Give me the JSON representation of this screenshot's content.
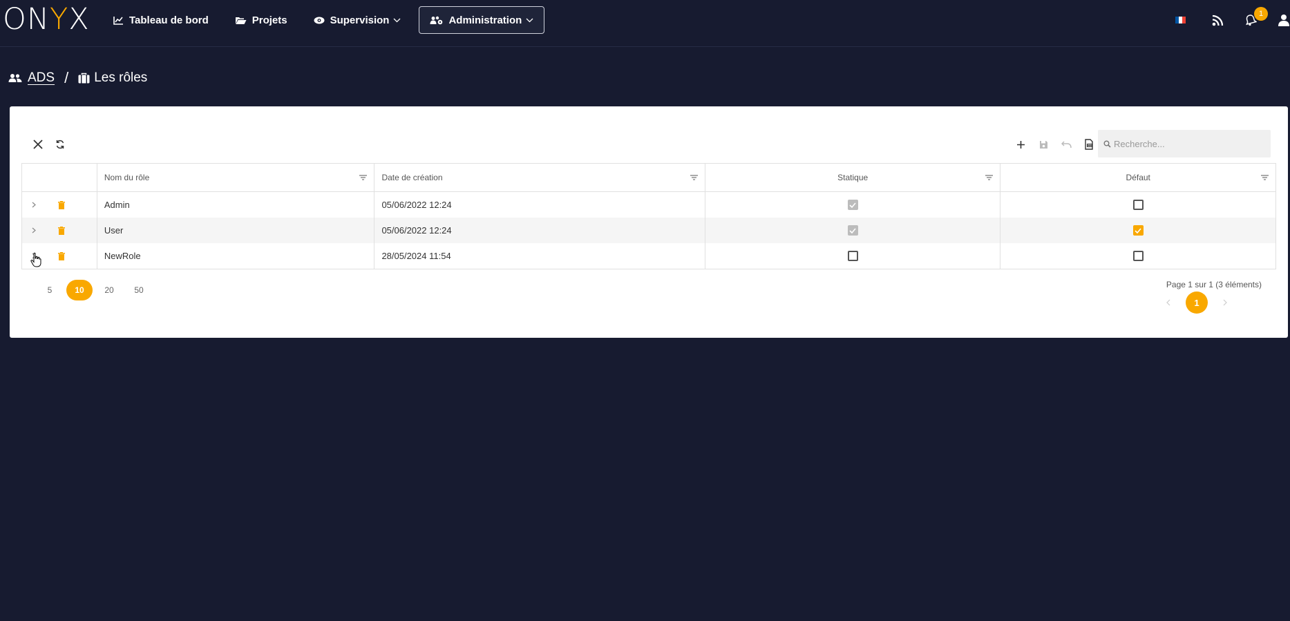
{
  "header": {
    "logo": {
      "part1": "ON",
      "part2": "Y",
      "part3": "X"
    },
    "nav": [
      {
        "label": "Tableau de bord",
        "icon": "chart-line-icon"
      },
      {
        "label": "Projets",
        "icon": "folder-open-icon"
      },
      {
        "label": "Supervision",
        "icon": "eye-icon",
        "has_dropdown": true
      },
      {
        "label": "Administration",
        "icon": "users-cog-icon",
        "has_dropdown": true,
        "active": true
      }
    ],
    "notification_count": "1"
  },
  "breadcrumb": {
    "parent": "ADS",
    "separator": "/",
    "current": "Les rôles"
  },
  "toolbar": {
    "search_placeholder": "Recherche..."
  },
  "grid": {
    "columns": [
      "Nom du rôle",
      "Date de création",
      "Statique",
      "Défaut"
    ],
    "rows": [
      {
        "name": "Admin",
        "date": "05/06/2022 12:24",
        "statique": true,
        "defaut": false
      },
      {
        "name": "User",
        "date": "05/06/2022 12:24",
        "statique": true,
        "defaut": true
      },
      {
        "name": "NewRole",
        "date": "28/05/2024 11:54",
        "statique": false,
        "defaut": false
      }
    ]
  },
  "pager": {
    "sizes": [
      "5",
      "10",
      "20",
      "50"
    ],
    "active_size": "10",
    "info": "Page 1 sur 1 (3 éléments)",
    "current_page": "1"
  },
  "colors": {
    "accent": "#f9a800",
    "background": "#171b30"
  }
}
